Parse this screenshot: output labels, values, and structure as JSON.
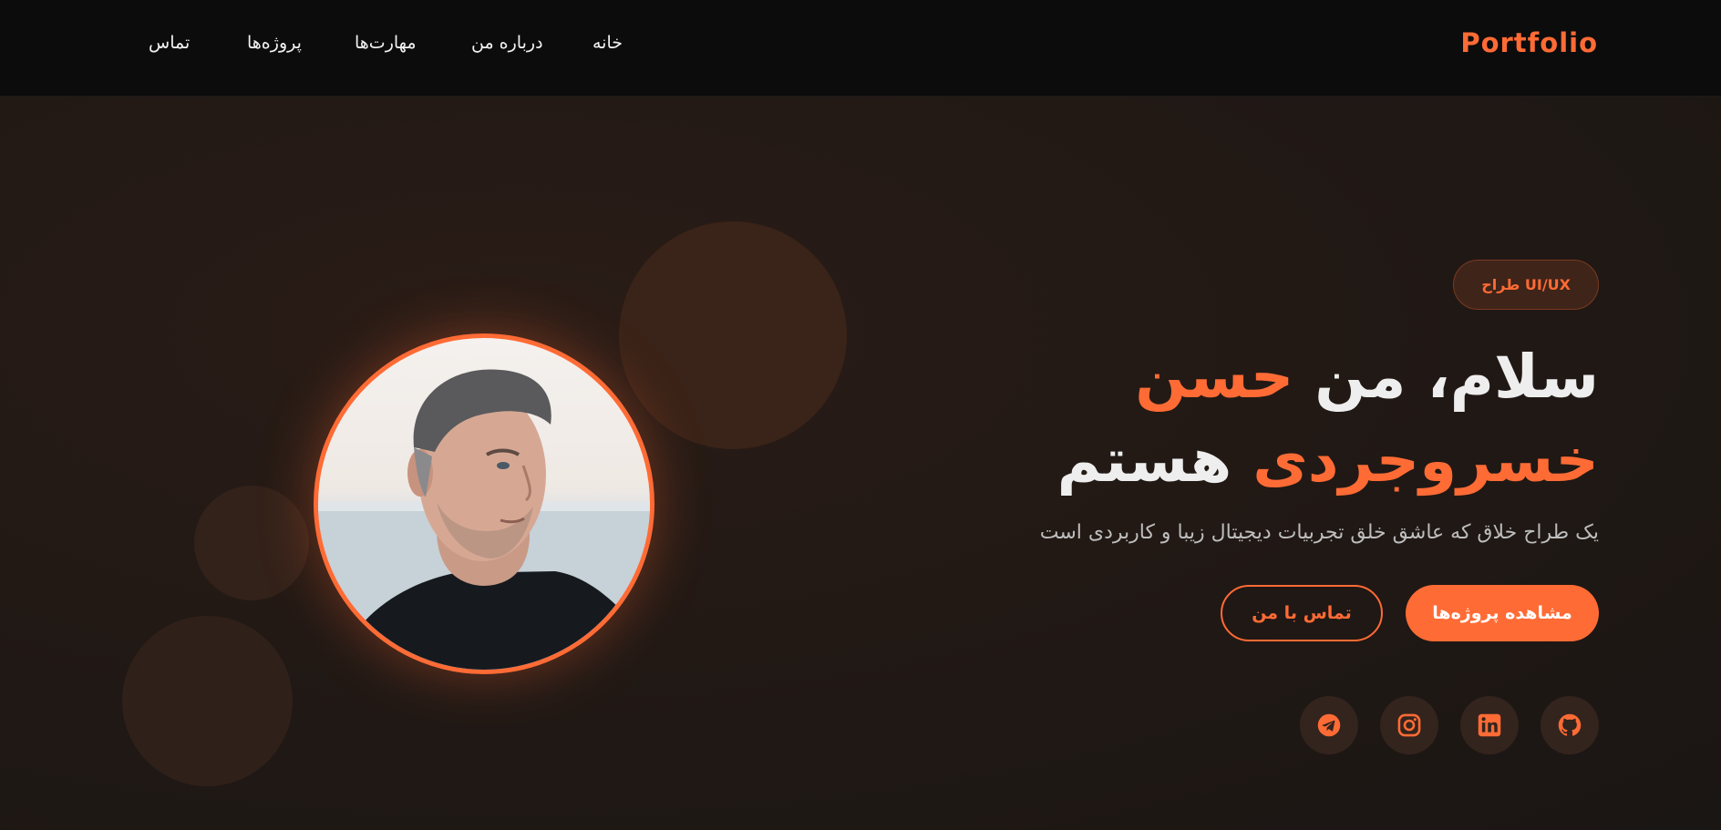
{
  "nav": {
    "brand": "Portfolio",
    "links": {
      "home": "خانه",
      "about": "درباره من",
      "skills": "مهارت‌ها",
      "projects": "پروژه‌ها",
      "contact": "تماس"
    }
  },
  "hero": {
    "badge": "طراح UI/UX",
    "title_prefix": "سلام، من ",
    "title_name": "حسن خسروجردی",
    "title_suffix": " هستم",
    "subtitle": "یک طراح خلاق که عاشق خلق تجربیات دیجیتال زیبا و کاربردی است",
    "primary_button": "مشاهده پروژه‌ها",
    "secondary_button": "تماس با من"
  },
  "social": [
    "github-icon",
    "linkedin-icon",
    "instagram-icon",
    "telegram-icon"
  ],
  "colors": {
    "accent": "#ff6b35",
    "navbar_bg": "#0c0c0c",
    "page_bg": "#1c1512"
  }
}
